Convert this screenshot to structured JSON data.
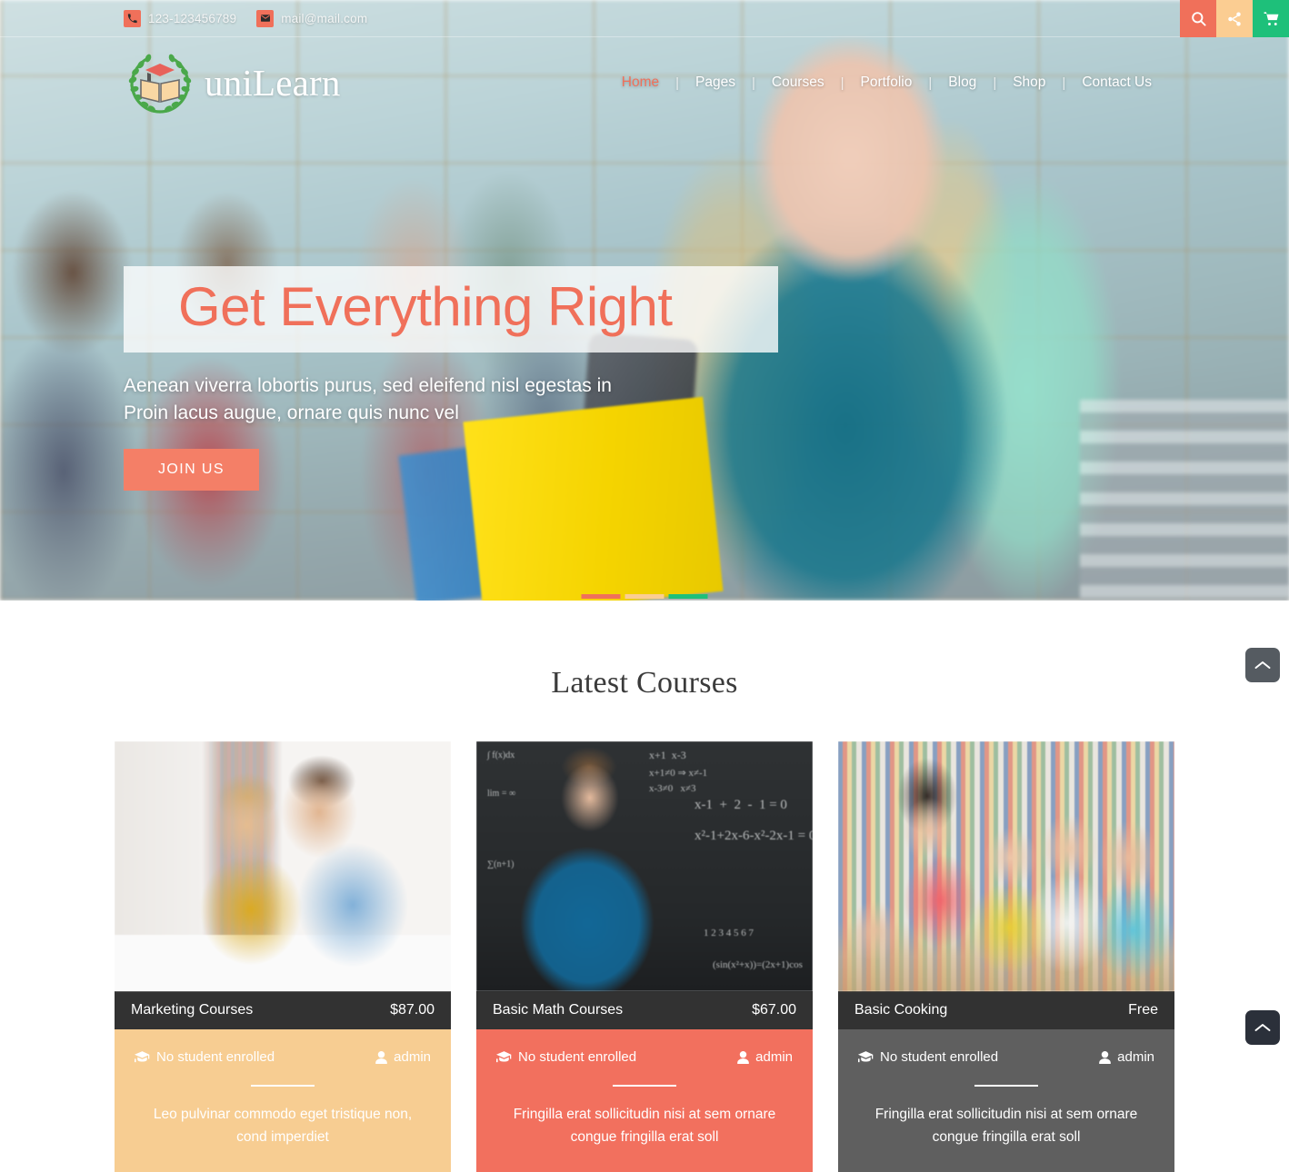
{
  "topbar": {
    "phone": "123-123456789",
    "email": "mail@mail.com",
    "phone_icon": "phone-icon",
    "email_icon": "envelope-icon",
    "actions": [
      {
        "name": "search-button",
        "icon": "search-icon",
        "color": "#f0705a"
      },
      {
        "name": "share-button",
        "icon": "share-icon",
        "color": "#fbcd92"
      },
      {
        "name": "cart-button",
        "icon": "cart-icon",
        "color": "#1ec07a"
      }
    ]
  },
  "brand": {
    "name": "uniLearn",
    "logo_icon": "laurel-book-logo-icon"
  },
  "nav": {
    "items": [
      {
        "label": "Home",
        "active": true
      },
      {
        "label": "Pages",
        "active": false
      },
      {
        "label": "Courses",
        "active": false
      },
      {
        "label": "Portfolio",
        "active": false
      },
      {
        "label": "Blog",
        "active": false
      },
      {
        "label": "Shop",
        "active": false
      },
      {
        "label": "Contact Us",
        "active": false
      }
    ],
    "separator": "|"
  },
  "hero": {
    "title": "Get Everything Right",
    "subtitle": "Aenean viverra lobortis purus, sed eleifend nisl egestas in Proin lacus augue, ornare quis nunc vel",
    "cta_label": "JOIN US",
    "slider_dots": [
      {
        "name": "slide-1",
        "color": "#f0705a",
        "active": true
      },
      {
        "name": "slide-2",
        "color": "#fbcd92",
        "active": false
      },
      {
        "name": "slide-3",
        "color": "#1ec07a",
        "active": false
      }
    ]
  },
  "courses": {
    "section_title": "Latest Courses",
    "enrolled_icon": "graduation-cap-icon",
    "author_icon": "user-icon",
    "cards": [
      {
        "title": "Marketing Courses",
        "price": "$87.00",
        "enrolled": "No student enrolled",
        "author": "admin",
        "description": "Leo pulvinar commodo eget tristique non, cond imperdiet",
        "body_color": "#f7cd92",
        "image_name": "marketing-course-image"
      },
      {
        "title": "Basic Math Courses",
        "price": "$67.00",
        "enrolled": "No student enrolled",
        "author": "admin",
        "description": "Fringilla erat sollicitudin nisi at sem ornare congue fringilla erat soll",
        "body_color": "#f2705e",
        "image_name": "basic-math-course-image"
      },
      {
        "title": "Basic Cooking",
        "price": "Free",
        "enrolled": "No student enrolled",
        "author": "admin",
        "description": "Fringilla erat sollicitudin nisi at sem ornare congue fringilla erat soll",
        "body_color": "#5f5f5f",
        "image_name": "basic-cooking-course-image"
      }
    ]
  },
  "floating": {
    "scroll_top_primary": "chevron-up-icon",
    "scroll_top_secondary": "chevron-up-icon"
  }
}
